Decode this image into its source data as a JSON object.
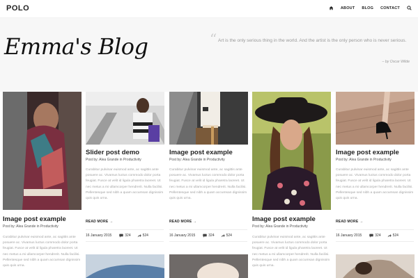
{
  "header": {
    "logo": "POLO",
    "nav": [
      "ABOUT",
      "BLOG",
      "CONTACT"
    ],
    "icons": [
      "home-icon",
      "search-icon"
    ]
  },
  "hero": {
    "title": "Emma's Blog",
    "quote": "Art is the only serious thing in the world. And the artist is the only person who is never serious.",
    "author": "– by Oscar Wilde"
  },
  "common": {
    "by": "Post by: Alea Grande in Productivity",
    "excerpt": "Curabitur pulvinar euismod ante, ac sagittis ante posuere ac. Vivamus luctus commodo dolor porta feugiat. Fusce at velit id ligula pharetra laoreet. Ut nec metus a mi ullamcorper hendrerit. Nulla facilisi. Pellentesque sed nibh a quam accumsan dignissim quis quis urna.",
    "more": "READ MORE →",
    "date": "16 January 2015",
    "comments": "324",
    "shares": "524"
  },
  "posts": [
    {
      "title": "Image post example"
    },
    {
      "title": "Slider post demo"
    },
    {
      "title": "Image post example"
    },
    {
      "title": "Image post example"
    },
    {
      "title": "Image post example"
    }
  ],
  "colors": {
    "accent": "#222222",
    "hero_bg": "#f7f7f7",
    "muted_text": "#a2a2a2"
  }
}
